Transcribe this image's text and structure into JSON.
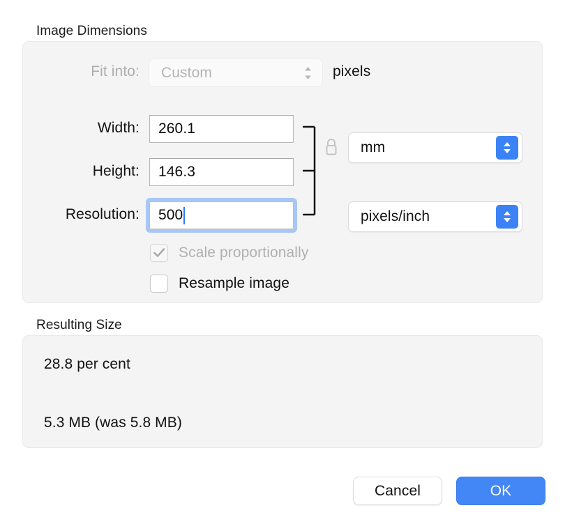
{
  "sections": {
    "dimensions": {
      "label": "Image Dimensions",
      "fit_into": {
        "label": "Fit into:",
        "value": "Custom",
        "suffix": "pixels",
        "enabled": false,
        "icon": "chevron-up-down-icon"
      },
      "width": {
        "label": "Width:",
        "value": "260.1"
      },
      "height": {
        "label": "Height:",
        "value": "146.3"
      },
      "resolution": {
        "label": "Resolution:",
        "value": "500",
        "focused": true
      },
      "link_icon": "lock-closed-icon",
      "size_unit": {
        "value": "mm",
        "icon": "stepper-chevrons-icon"
      },
      "resolution_unit": {
        "value": "pixels/inch",
        "icon": "stepper-chevrons-icon"
      },
      "scale_proportionally": {
        "label": "Scale proportionally",
        "checked": true,
        "enabled": false
      },
      "resample_image": {
        "label": "Resample image",
        "checked": false,
        "enabled": true
      }
    },
    "resulting_size": {
      "label": "Resulting Size",
      "percent": "28.8 per cent",
      "file_size": "5.3 MB (was 5.8 MB)"
    }
  },
  "footer": {
    "cancel_label": "Cancel",
    "ok_label": "OK"
  },
  "colors": {
    "accent": "#4287f5",
    "stepper": "#3b82f7",
    "focus_ring": "#a8c7f5",
    "caret": "#2e7bf6",
    "group_background": "#f4f4f5",
    "disabled_text": "#b4b4b6"
  }
}
